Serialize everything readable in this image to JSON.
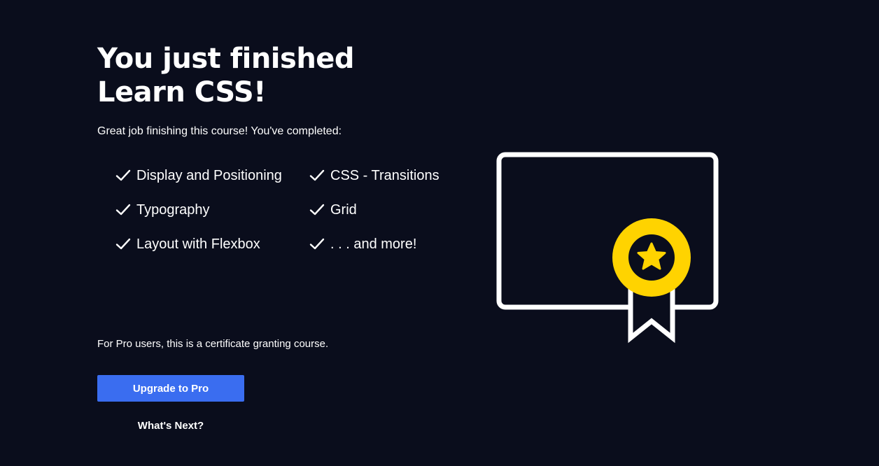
{
  "heading": {
    "line1": "You just finished",
    "line2": "Learn CSS!"
  },
  "subtitle": "Great job finishing this course! You've completed:",
  "completed_items": [
    "Display and Positioning",
    "CSS - Transitions",
    "Typography",
    "Grid",
    "Layout with Flexbox",
    ". . . and more!"
  ],
  "note": "For Pro users, this is a certificate granting course.",
  "buttons": {
    "upgrade_label": "Upgrade to Pro",
    "whats_next_label": "What's Next?"
  },
  "icons": {
    "check": "check-icon",
    "certificate": "certificate-icon",
    "star": "star-icon"
  },
  "colors": {
    "background": "#0a0d1c",
    "primary_button": "#3a6df0",
    "badge": "#ffd300",
    "text": "#ffffff"
  }
}
